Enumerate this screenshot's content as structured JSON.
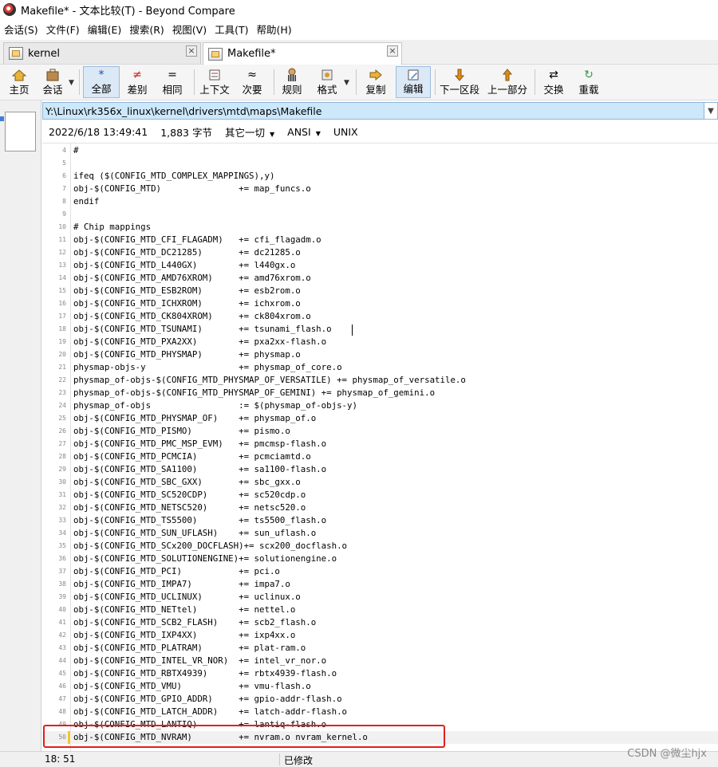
{
  "window": {
    "title": "Makefile* - 文本比较(T) - Beyond Compare"
  },
  "menu": [
    "会话(S)",
    "文件(F)",
    "编辑(E)",
    "搜索(R)",
    "视图(V)",
    "工具(T)",
    "帮助(H)"
  ],
  "tabs": [
    {
      "label": "kernel",
      "close": "×"
    },
    {
      "label": "Makefile*",
      "close": "×"
    }
  ],
  "toolbar": {
    "home": "主页",
    "session": "会话",
    "all": "全部",
    "diffs": "差别",
    "same": "相同",
    "context": "上下文",
    "minor": "次要",
    "rules": "规则",
    "format": "格式",
    "copy": "复制",
    "edit": "编辑",
    "next_section": "下一区段",
    "prev_part": "上一部分",
    "swap": "交换",
    "reload": "重载"
  },
  "file": {
    "path": "Y:\\Linux\\rk356x_linux\\kernel\\drivers\\mtd\\maps\\Makefile",
    "date": "2022/6/18 13:49:41",
    "size": "1,883 字节",
    "format": "其它一切",
    "encoding": "ANSI",
    "line_ending": "UNIX"
  },
  "code_lines": [
    {
      "n": "4",
      "text": "#"
    },
    {
      "n": "5",
      "text": ""
    },
    {
      "n": "6",
      "text": "ifeq ($(CONFIG_MTD_COMPLEX_MAPPINGS),y)"
    },
    {
      "n": "7",
      "text": "obj-$(CONFIG_MTD)               += map_funcs.o"
    },
    {
      "n": "8",
      "text": "endif"
    },
    {
      "n": "9",
      "text": ""
    },
    {
      "n": "10",
      "text": "# Chip mappings"
    },
    {
      "n": "11",
      "text": "obj-$(CONFIG_MTD_CFI_FLAGADM)   += cfi_flagadm.o"
    },
    {
      "n": "12",
      "text": "obj-$(CONFIG_MTD_DC21285)       += dc21285.o"
    },
    {
      "n": "13",
      "text": "obj-$(CONFIG_MTD_L440GX)        += l440gx.o"
    },
    {
      "n": "14",
      "text": "obj-$(CONFIG_MTD_AMD76XROM)     += amd76xrom.o"
    },
    {
      "n": "15",
      "text": "obj-$(CONFIG_MTD_ESB2ROM)       += esb2rom.o"
    },
    {
      "n": "16",
      "text": "obj-$(CONFIG_MTD_ICHXROM)       += ichxrom.o"
    },
    {
      "n": "17",
      "text": "obj-$(CONFIG_MTD_CK804XROM)     += ck804xrom.o"
    },
    {
      "n": "18",
      "text": "obj-$(CONFIG_MTD_TSUNAMI)       += tsunami_flash.o"
    },
    {
      "n": "19",
      "text": "obj-$(CONFIG_MTD_PXA2XX)        += pxa2xx-flash.o"
    },
    {
      "n": "20",
      "text": "obj-$(CONFIG_MTD_PHYSMAP)       += physmap.o"
    },
    {
      "n": "21",
      "text": "physmap-objs-y                  += physmap_of_core.o"
    },
    {
      "n": "22",
      "text": "physmap_of-objs-$(CONFIG_MTD_PHYSMAP_OF_VERSATILE) += physmap_of_versatile.o"
    },
    {
      "n": "23",
      "text": "physmap_of-objs-$(CONFIG_MTD_PHYSMAP_OF_GEMINI) += physmap_of_gemini.o"
    },
    {
      "n": "24",
      "text": "physmap_of-objs                 := $(physmap_of-objs-y)"
    },
    {
      "n": "25",
      "text": "obj-$(CONFIG_MTD_PHYSMAP_OF)    += physmap_of.o"
    },
    {
      "n": "26",
      "text": "obj-$(CONFIG_MTD_PISMO)         += pismo.o"
    },
    {
      "n": "27",
      "text": "obj-$(CONFIG_MTD_PMC_MSP_EVM)   += pmcmsp-flash.o"
    },
    {
      "n": "28",
      "text": "obj-$(CONFIG_MTD_PCMCIA)        += pcmciamtd.o"
    },
    {
      "n": "29",
      "text": "obj-$(CONFIG_MTD_SA1100)        += sa1100-flash.o"
    },
    {
      "n": "30",
      "text": "obj-$(CONFIG_MTD_SBC_GXX)       += sbc_gxx.o"
    },
    {
      "n": "31",
      "text": "obj-$(CONFIG_MTD_SC520CDP)      += sc520cdp.o"
    },
    {
      "n": "32",
      "text": "obj-$(CONFIG_MTD_NETSC520)      += netsc520.o"
    },
    {
      "n": "33",
      "text": "obj-$(CONFIG_MTD_TS5500)        += ts5500_flash.o"
    },
    {
      "n": "34",
      "text": "obj-$(CONFIG_MTD_SUN_UFLASH)    += sun_uflash.o"
    },
    {
      "n": "35",
      "text": "obj-$(CONFIG_MTD_SCx200_DOCFLASH)+= scx200_docflash.o"
    },
    {
      "n": "36",
      "text": "obj-$(CONFIG_MTD_SOLUTIONENGINE)+= solutionengine.o"
    },
    {
      "n": "37",
      "text": "obj-$(CONFIG_MTD_PCI)           += pci.o"
    },
    {
      "n": "38",
      "text": "obj-$(CONFIG_MTD_IMPA7)         += impa7.o"
    },
    {
      "n": "39",
      "text": "obj-$(CONFIG_MTD_UCLINUX)       += uclinux.o"
    },
    {
      "n": "40",
      "text": "obj-$(CONFIG_MTD_NETtel)        += nettel.o"
    },
    {
      "n": "41",
      "text": "obj-$(CONFIG_MTD_SCB2_FLASH)    += scb2_flash.o"
    },
    {
      "n": "42",
      "text": "obj-$(CONFIG_MTD_IXP4XX)        += ixp4xx.o"
    },
    {
      "n": "43",
      "text": "obj-$(CONFIG_MTD_PLATRAM)       += plat-ram.o"
    },
    {
      "n": "44",
      "text": "obj-$(CONFIG_MTD_INTEL_VR_NOR)  += intel_vr_nor.o"
    },
    {
      "n": "45",
      "text": "obj-$(CONFIG_MTD_RBTX4939)      += rbtx4939-flash.o"
    },
    {
      "n": "46",
      "text": "obj-$(CONFIG_MTD_VMU)           += vmu-flash.o"
    },
    {
      "n": "47",
      "text": "obj-$(CONFIG_MTD_GPIO_ADDR)     += gpio-addr-flash.o"
    },
    {
      "n": "48",
      "text": "obj-$(CONFIG_MTD_LATCH_ADDR)    += latch-addr-flash.o"
    },
    {
      "n": "49",
      "text": "obj-$(CONFIG_MTD_LANTIQ)        += lantiq-flash.o"
    },
    {
      "n": "50",
      "text": "obj-$(CONFIG_MTD_NVRAM)         += nvram.o nvram_kernel.o"
    }
  ],
  "status": {
    "position": "18: 51",
    "modified": "已修改"
  },
  "watermark": "CSDN @微尘hjx"
}
